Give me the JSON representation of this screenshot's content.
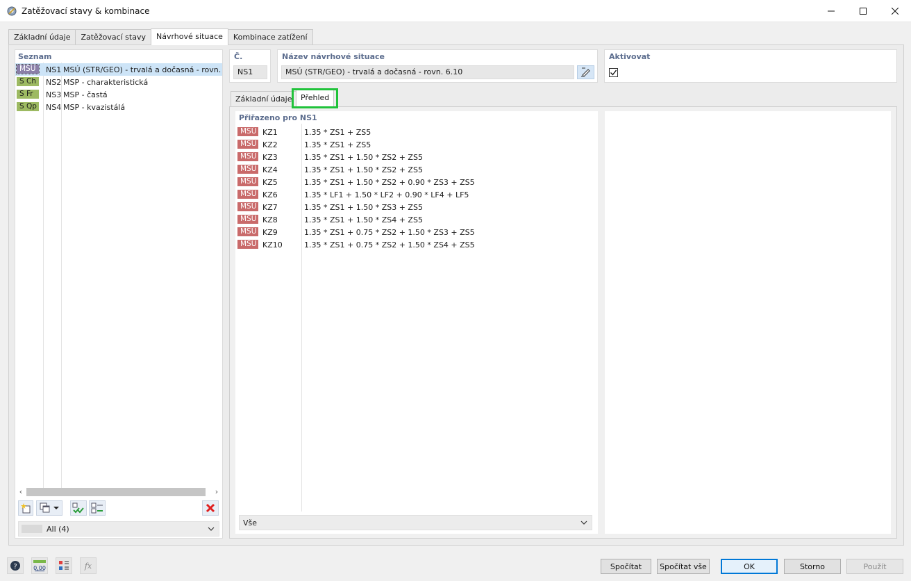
{
  "window": {
    "title": "Zatěžovací stavy & kombinace",
    "icon": "app-gear-icon"
  },
  "main_tabs": [
    {
      "label": "Základní údaje"
    },
    {
      "label": "Zatěžovací stavy"
    },
    {
      "label": "Návrhové situace",
      "active": true
    },
    {
      "label": "Kombinace zatížení"
    }
  ],
  "list": {
    "title": "Seznam",
    "items": [
      {
        "badge": "MSÚ",
        "badge_color": "#8a7fa8",
        "code": "NS1",
        "name": "MSÚ (STR/GEO) - trvalá a dočasná - rovn. 6.10",
        "selected": true
      },
      {
        "badge": "S Ch",
        "badge_color": "#9dba62",
        "code": "NS2",
        "name": "MSP - charakteristická"
      },
      {
        "badge": "S Fr",
        "badge_color": "#9dba62",
        "code": "NS3",
        "name": "MSP - častá"
      },
      {
        "badge": "S Qp",
        "badge_color": "#9dba62",
        "code": "NS4",
        "name": "MSP - kvazistálá"
      }
    ],
    "filter_value": "All (4)"
  },
  "fields": {
    "number_label": "Č.",
    "number_value": "NS1",
    "name_label": "Název návrhové situace",
    "name_value": "MSÚ (STR/GEO) - trvalá a dočasná - rovn. 6.10",
    "activate_label": "Aktivovat",
    "activate_checked": true
  },
  "sub_tabs": [
    {
      "label": "Základní údaje"
    },
    {
      "label": "Přehled",
      "active": true
    }
  ],
  "overview": {
    "title": "Přiřazeno pro NS1",
    "badge_color": "#c96a6a",
    "rows": [
      {
        "badge": "MSÚ",
        "kz": "KZ1",
        "expr": "1.35 * ZS1 + ZS5"
      },
      {
        "badge": "MSÚ",
        "kz": "KZ2",
        "expr": "1.35 * ZS1 + ZS5"
      },
      {
        "badge": "MSÚ",
        "kz": "KZ3",
        "expr": "1.35 * ZS1 + 1.50 * ZS2 + ZS5"
      },
      {
        "badge": "MSÚ",
        "kz": "KZ4",
        "expr": "1.35 * ZS1 + 1.50 * ZS2 + ZS5"
      },
      {
        "badge": "MSÚ",
        "kz": "KZ5",
        "expr": "1.35 * ZS1 + 1.50 * ZS2 + 0.90 * ZS3 + ZS5"
      },
      {
        "badge": "MSÚ",
        "kz": "KZ6",
        "expr": "1.35 * LF1 + 1.50 * LF2 + 0.90 * LF4 + LF5"
      },
      {
        "badge": "MSÚ",
        "kz": "KZ7",
        "expr": "1.35 * ZS1 + 1.50 * ZS3 + ZS5"
      },
      {
        "badge": "MSÚ",
        "kz": "KZ8",
        "expr": "1.35 * ZS1 + 1.50 * ZS4 + ZS5"
      },
      {
        "badge": "MSÚ",
        "kz": "KZ9",
        "expr": "1.35 * ZS1 + 0.75 * ZS2 + 1.50 * ZS3 + ZS5"
      },
      {
        "badge": "MSÚ",
        "kz": "KZ10",
        "expr": "1.35 * ZS1 + 0.75 * ZS2 + 1.50 * ZS4 + ZS5"
      }
    ],
    "filter_value": "Vše"
  },
  "bottom_buttons": {
    "compute": "Spočítat",
    "compute_all": "Spočítat vše",
    "ok": "OK",
    "cancel": "Storno",
    "apply": "Použít"
  },
  "bottom_icons": [
    "help-icon",
    "units-icon",
    "model-info-icon",
    "formula-icon"
  ],
  "units_icon_text": "0,00",
  "formula_icon_text": "fx",
  "colors": {
    "accent": "#0078d7",
    "highlight": "#20c33a",
    "delete": "#e02020"
  }
}
